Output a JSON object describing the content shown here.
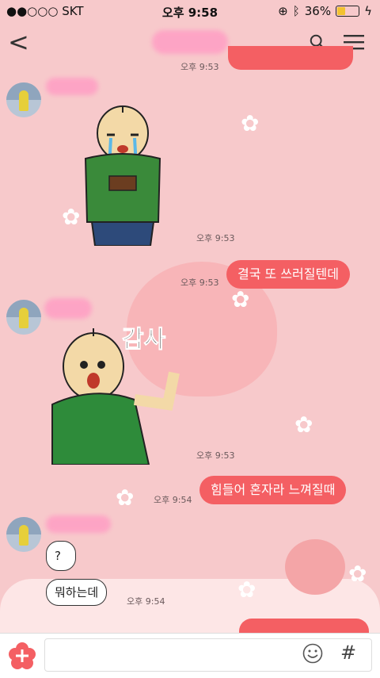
{
  "status_bar": {
    "carrier": "●●○○○ SKT",
    "time": "오후 9:58",
    "battery": "36%",
    "battery_level": 0.36
  },
  "nav": {
    "back": "<"
  },
  "messages": {
    "first_time": "오후 9:53",
    "sticker1_time": "오후 9:53",
    "me1": {
      "text": "결국 또 쓰러질텐데",
      "time": "오후 9:53"
    },
    "sticker2_time": "오후 9:53",
    "sticker2_caption": "감사",
    "me2": {
      "text": "힘들어 혼자라 느껴질때",
      "time": "오후 9:54"
    },
    "them_q": "?",
    "them_text": "뭐하는데",
    "them_time": "오후 9:54"
  },
  "composer": {
    "hash": "#"
  },
  "colors": {
    "background": "#f7c9cb",
    "my_bubble": "#f45f63"
  }
}
